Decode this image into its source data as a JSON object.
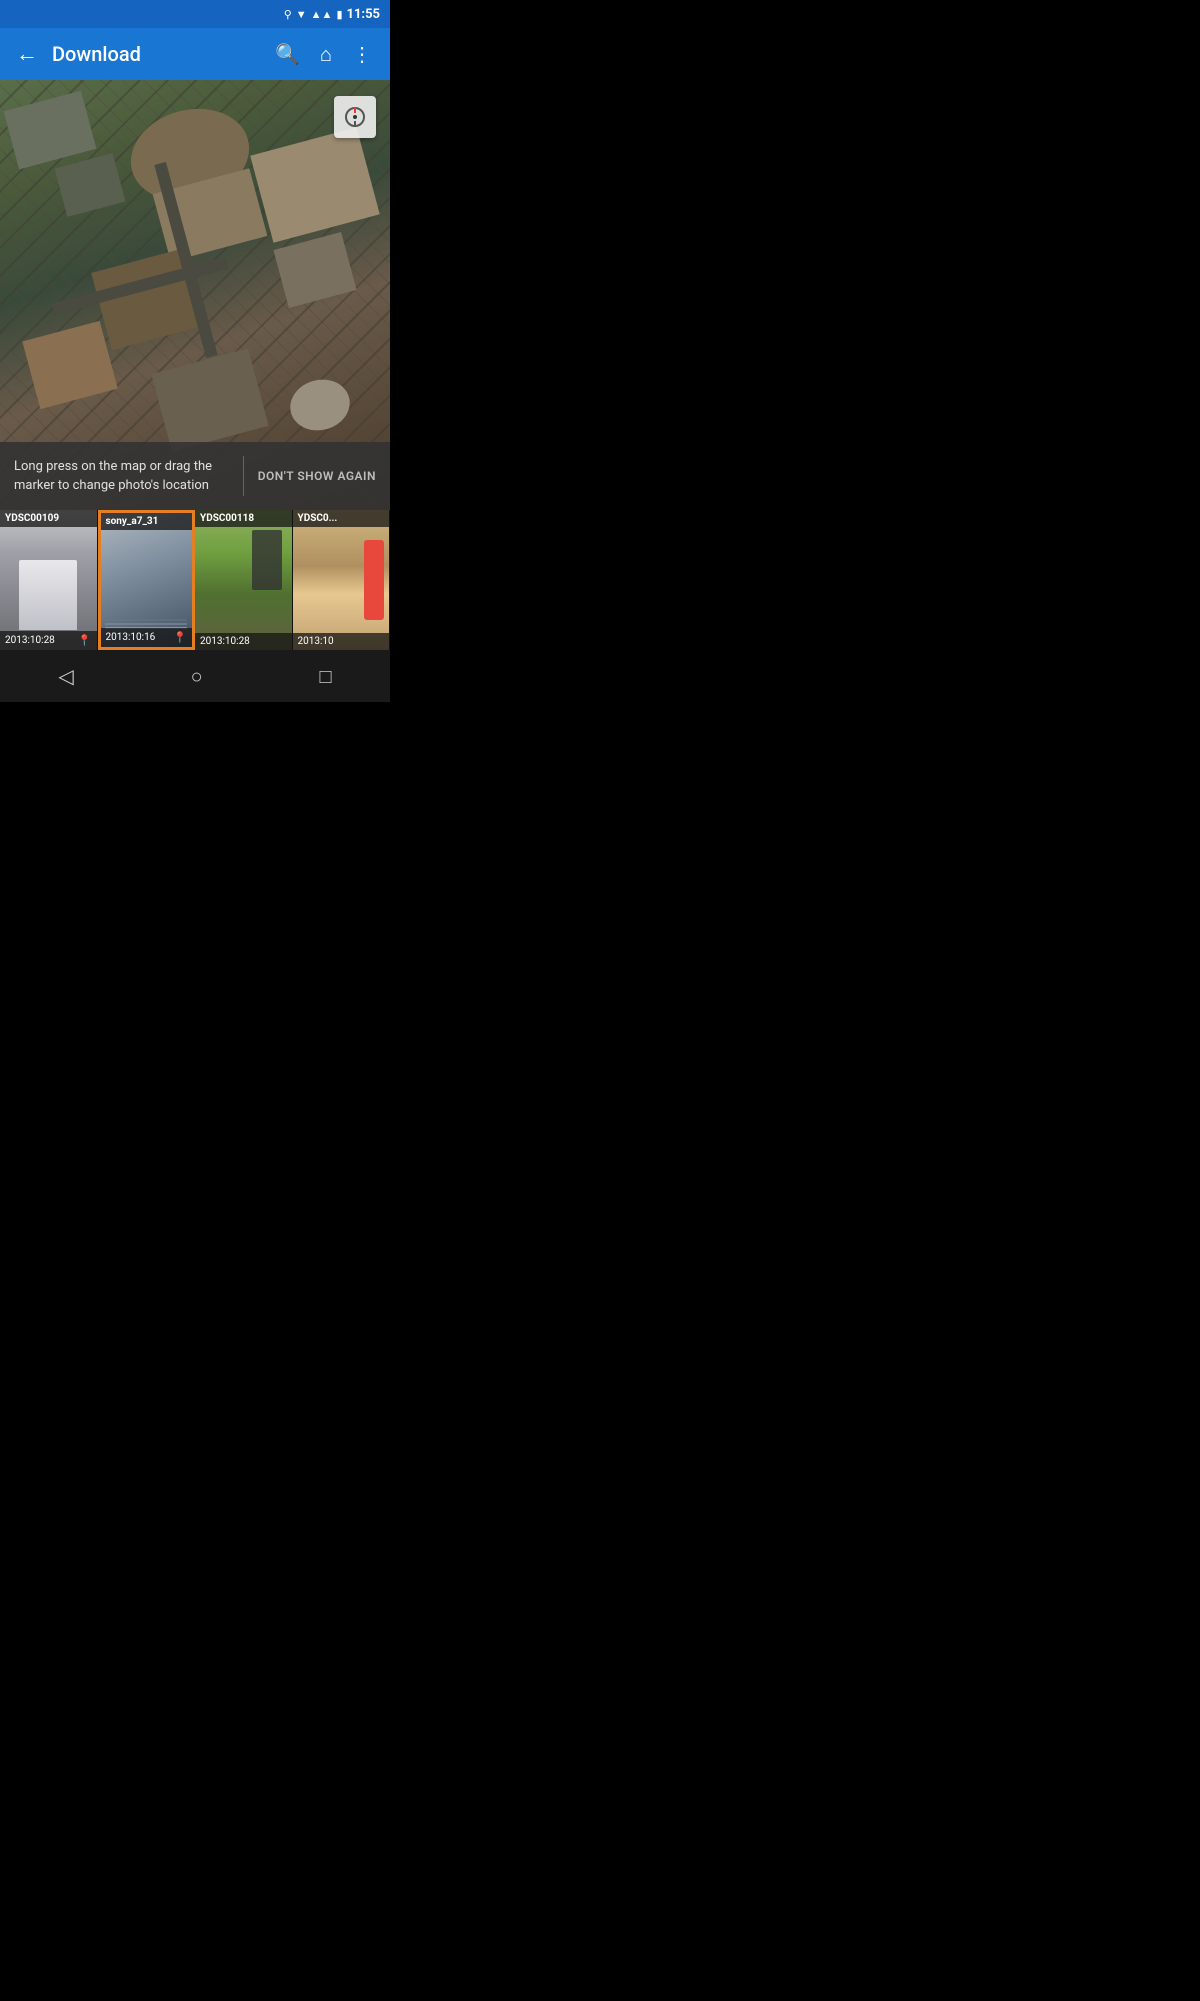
{
  "statusBar": {
    "time": "11:55",
    "icons": [
      "location",
      "wifi",
      "signal",
      "battery"
    ]
  },
  "appBar": {
    "title": "Download",
    "backLabel": "←",
    "searchLabel": "🔍",
    "homeLabel": "⌂",
    "menuLabel": "⋮"
  },
  "map": {
    "compassLabel": "◎",
    "hintText": "Long press on the map or drag the marker to change photo's location",
    "hintAction": "DON'T SHOW AGAIN"
  },
  "photos": [
    {
      "id": "p1",
      "label": "YDSC00109",
      "date": "2013:10:28",
      "hasLocation": true,
      "selected": false
    },
    {
      "id": "p2",
      "label": "sony_a7_31",
      "date": "2013:10:16",
      "hasLocation": true,
      "selected": true
    },
    {
      "id": "p3",
      "label": "YDSC00118",
      "date": "2013:10:28",
      "hasLocation": false,
      "selected": false
    },
    {
      "id": "p4",
      "label": "YDSC0...",
      "date": "2013:10",
      "hasLocation": false,
      "selected": false,
      "partial": true
    }
  ],
  "navBar": {
    "backBtn": "◁",
    "homeBtn": "○",
    "recentBtn": "□"
  }
}
